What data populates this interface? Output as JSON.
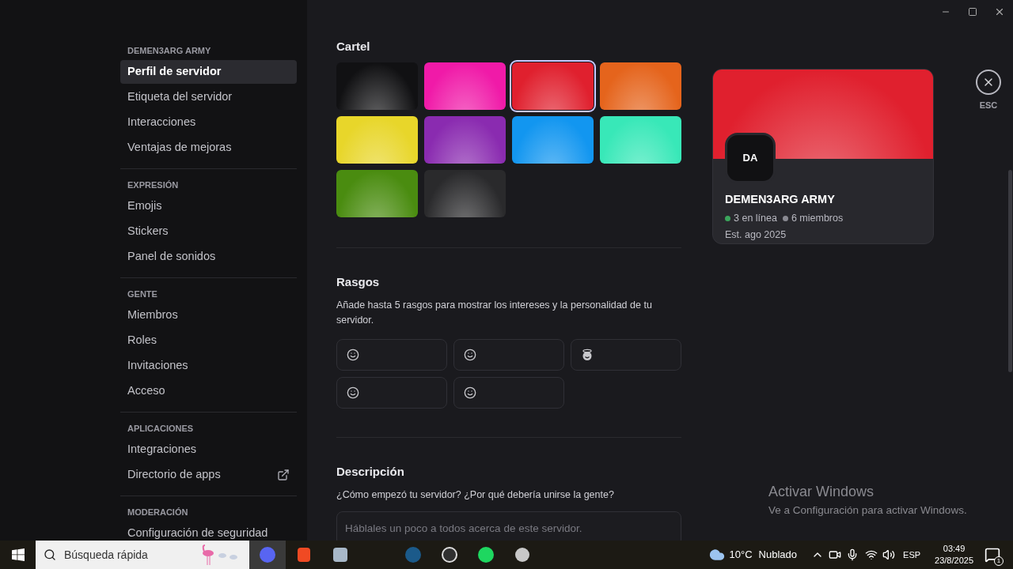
{
  "sidebar": {
    "sections": [
      {
        "title": "DEMEN3ARG ARMY",
        "items": [
          {
            "label": "Perfil de servidor",
            "selected": true
          },
          {
            "label": "Etiqueta del servidor",
            "selected": false
          },
          {
            "label": "Interacciones",
            "selected": false
          },
          {
            "label": "Ventajas de mejoras",
            "selected": false
          }
        ]
      },
      {
        "title": "EXPRESIÓN",
        "items": [
          {
            "label": "Emojis",
            "selected": false
          },
          {
            "label": "Stickers",
            "selected": false
          },
          {
            "label": "Panel de sonidos",
            "selected": false
          }
        ]
      },
      {
        "title": "GENTE",
        "items": [
          {
            "label": "Miembros",
            "selected": false
          },
          {
            "label": "Roles",
            "selected": false
          },
          {
            "label": "Invitaciones",
            "selected": false
          },
          {
            "label": "Acceso",
            "selected": false
          }
        ]
      },
      {
        "title": "APLICACIONES",
        "items": [
          {
            "label": "Integraciones",
            "selected": false
          },
          {
            "label": "Directorio de apps",
            "selected": false,
            "external": true
          }
        ]
      },
      {
        "title": "MODERACIÓN",
        "items": [
          {
            "label": "Configuración de seguridad",
            "selected": false
          }
        ]
      }
    ]
  },
  "banner": {
    "title": "Cartel",
    "swatches": [
      {
        "color": "#111113",
        "selected": false
      },
      {
        "color": "#f01aa8",
        "selected": false
      },
      {
        "color": "#e0202e",
        "selected": true
      },
      {
        "color": "#e5641c",
        "selected": false
      },
      {
        "color": "#e8d62a",
        "selected": false
      },
      {
        "color": "#8a2bb0",
        "selected": false
      },
      {
        "color": "#1296f0",
        "selected": false
      },
      {
        "color": "#38e8b8",
        "selected": false
      },
      {
        "color": "#4a8c10",
        "selected": false
      },
      {
        "color": "#2a2a2c",
        "selected": false
      }
    ]
  },
  "traits": {
    "title": "Rasgos",
    "description": "Añade hasta 5 rasgos para mostrar los intereses y la personalidad de tu servidor.",
    "slots": [
      {
        "kind": "smile"
      },
      {
        "kind": "smile"
      },
      {
        "kind": "halo"
      },
      {
        "kind": "smile"
      },
      {
        "kind": "smile"
      }
    ]
  },
  "description": {
    "title": "Descripción",
    "prompt": "¿Cómo empezó tu servidor? ¿Por qué debería unirse la gente?",
    "placeholder": "Háblales un poco a todos acerca de este servidor."
  },
  "preview": {
    "initials": "DA",
    "name": "DEMEN3ARG ARMY",
    "online": "3 en línea",
    "members": "6 miembros",
    "established": "Est. ago 2025"
  },
  "close": {
    "label": "ESC"
  },
  "activation": {
    "title": "Activar Windows",
    "subtitle": "Ve a Configuración para activar Windows."
  },
  "taskbar": {
    "search_placeholder": "Búsqueda rápida",
    "weather": "10°C",
    "condition": "Nublado",
    "language": "ESP",
    "time": "03:49",
    "date": "23/8/2025",
    "notifications": "1"
  }
}
